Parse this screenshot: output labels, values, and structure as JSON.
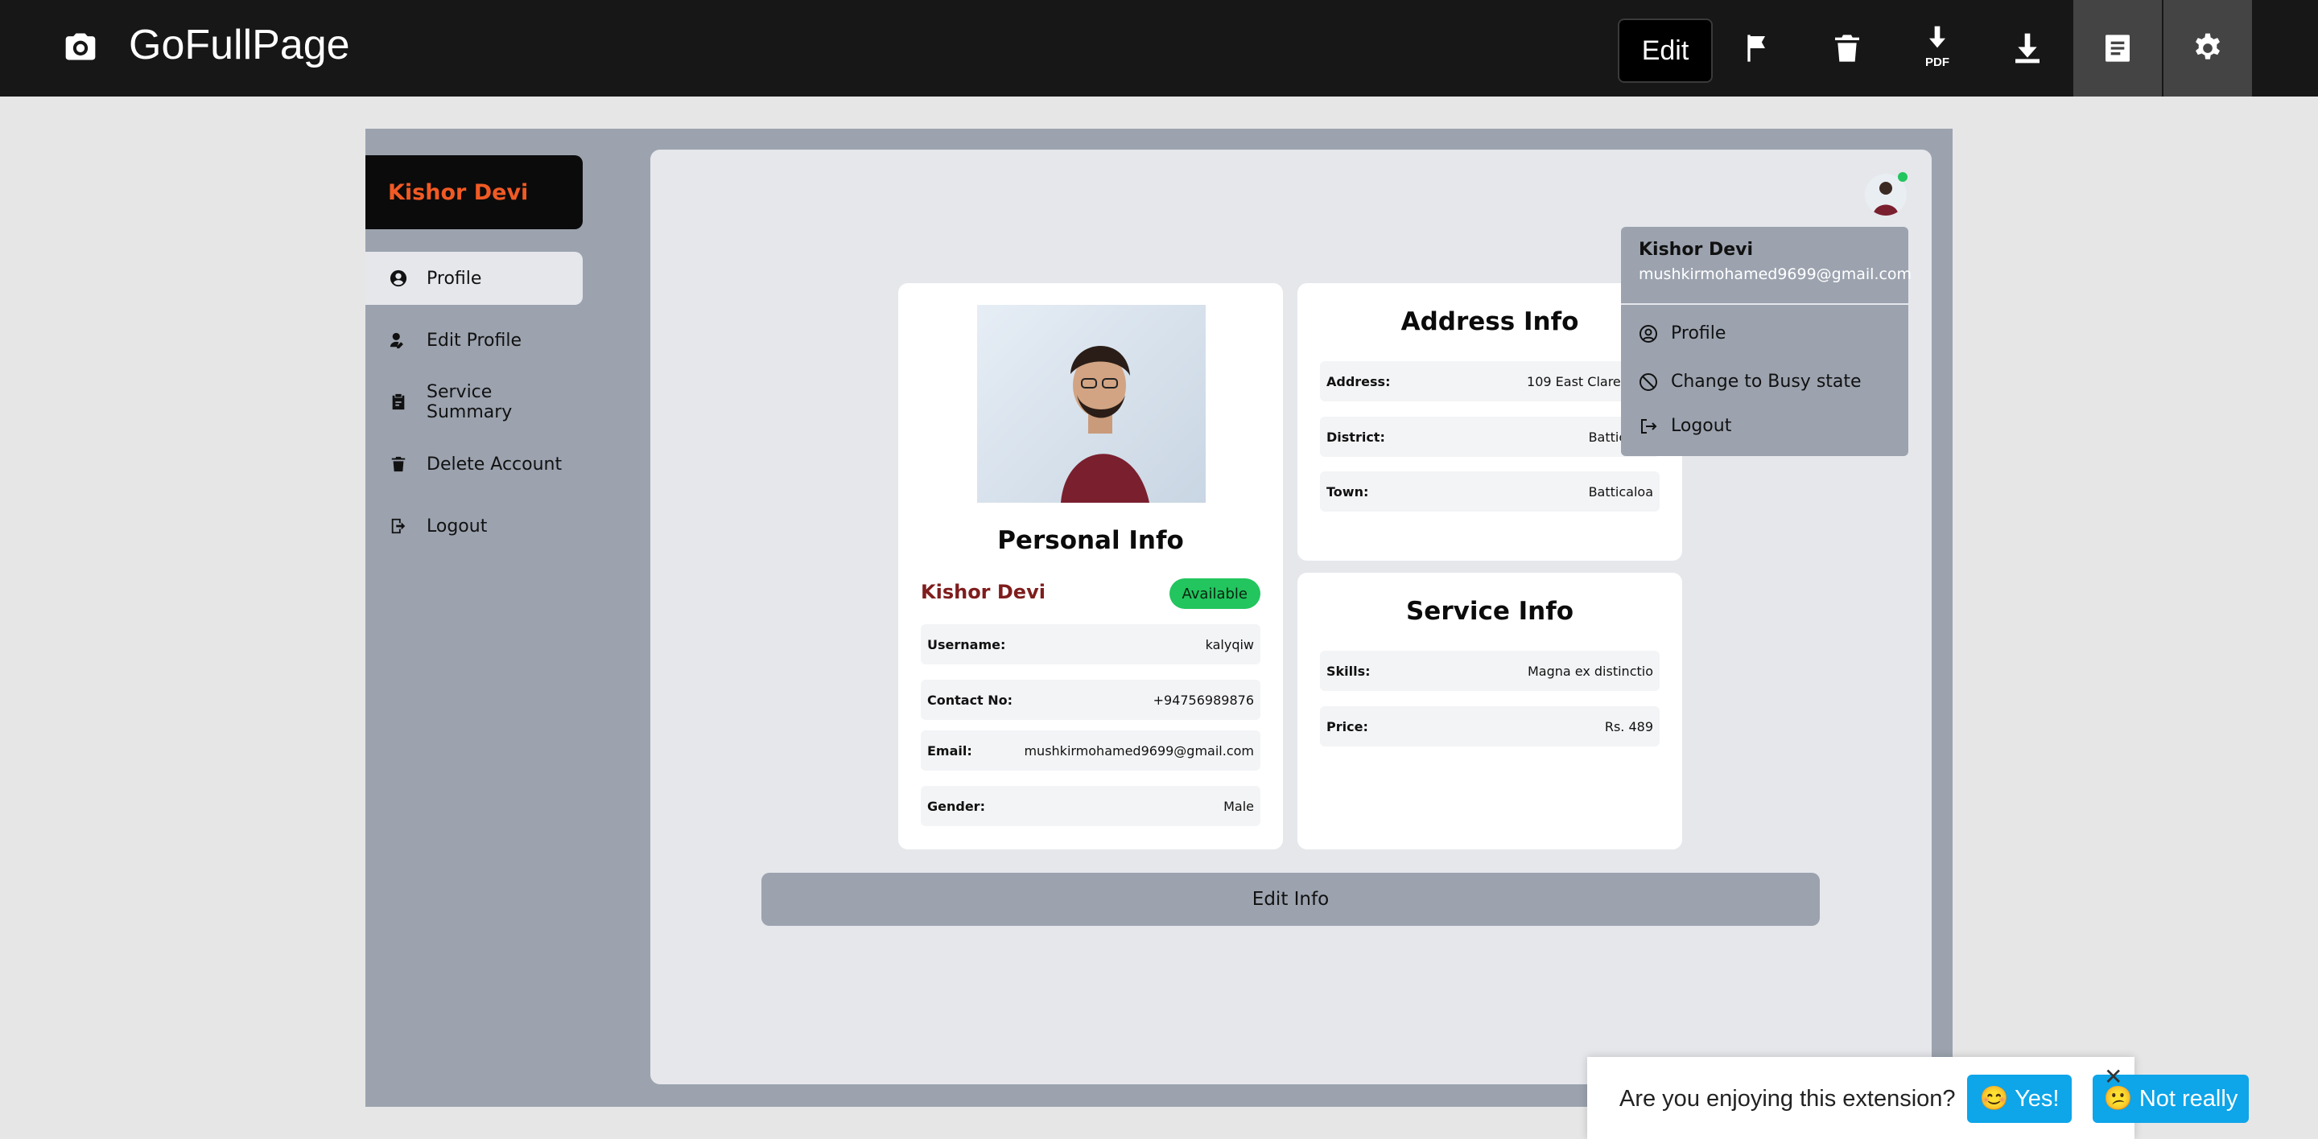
{
  "toolbar": {
    "brand": "GoFullPage",
    "edit_label": "Edit",
    "pdf_label": "PDF",
    "icons": [
      "camera-icon",
      "flag-icon",
      "trash-icon",
      "download-pdf-icon",
      "download-icon",
      "document-icon",
      "gear-icon"
    ]
  },
  "sidebar": {
    "title": "Kishor Devi",
    "items": [
      {
        "label": "Profile",
        "icon": "user-circle-icon"
      },
      {
        "label": "Edit Profile",
        "icon": "user-edit-icon"
      },
      {
        "label": "Service Summary",
        "icon": "clipboard-icon"
      },
      {
        "label": "Delete Account",
        "icon": "trash-icon"
      },
      {
        "label": "Logout",
        "icon": "logout-icon"
      }
    ]
  },
  "personal": {
    "title": "Personal Info",
    "name": "Kishor Devi",
    "status": "Available",
    "rows": [
      {
        "key": "Username:",
        "value": "kalyqiw"
      },
      {
        "key": "Contact No:",
        "value": "+94756989876"
      },
      {
        "key": "Email:",
        "value": "mushkirmohamed9699@gmail.com"
      },
      {
        "key": "Gender:",
        "value": "Male"
      }
    ]
  },
  "address": {
    "title": "Address Info",
    "rows": [
      {
        "key": "Address:",
        "value": "109 East Clarendon"
      },
      {
        "key": "District:",
        "value": "Batticaloa"
      },
      {
        "key": "Town:",
        "value": "Batticaloa"
      }
    ]
  },
  "service": {
    "title": "Service Info",
    "rows": [
      {
        "key": "Skills:",
        "value": "Magna ex distinctio"
      },
      {
        "key": "Price:",
        "value": "Rs. 489"
      }
    ]
  },
  "edit_info_label": "Edit Info",
  "dropdown": {
    "name": "Kishor Devi",
    "email": "mushkirmohamed9699@gmail.com",
    "items": [
      {
        "label": "Profile",
        "icon": "user-circle-icon"
      },
      {
        "label": "Change to Busy state",
        "icon": "ban-icon"
      },
      {
        "label": "Logout",
        "icon": "logout-icon"
      }
    ]
  },
  "feedback": {
    "question": "Are you enjoying this extension?",
    "yes": "😊 Yes!",
    "no": "😕 Not really",
    "close": "✕"
  },
  "colors": {
    "toolbar_bg": "#171717",
    "accent_orange": "#f15a24",
    "available_green": "#22c55e",
    "name_maroon": "#7f1d1d",
    "button_blue": "#0ea5e9"
  }
}
